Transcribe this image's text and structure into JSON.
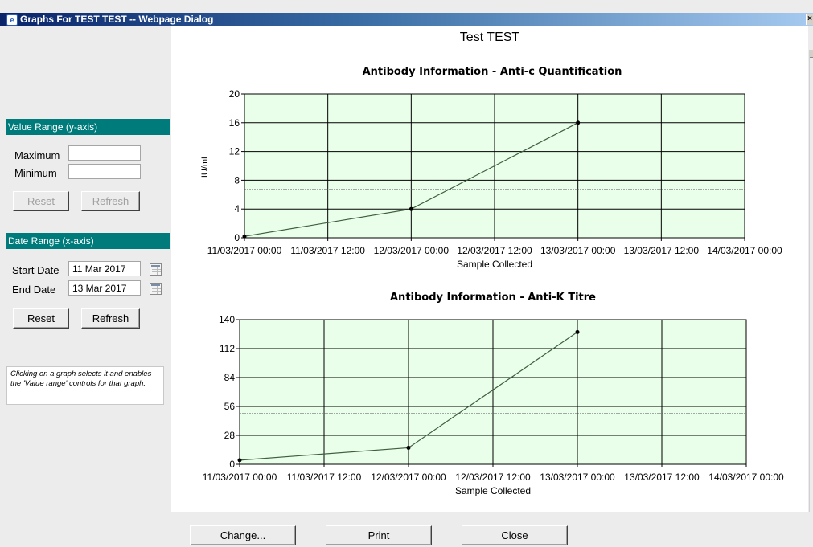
{
  "window": {
    "title": "Graphs For TEST TEST -- Webpage Dialog",
    "icon": "ie-page-icon"
  },
  "page": {
    "title": "Test TEST"
  },
  "value_range": {
    "header": "Value Range (y-axis)",
    "max_label": "Maximum",
    "min_label": "Minimum",
    "max_value": "",
    "min_value": "",
    "reset_label": "Reset",
    "refresh_label": "Refresh",
    "enabled": false
  },
  "date_range": {
    "header": "Date Range (x-axis)",
    "start_label": "Start Date",
    "end_label": "End Date",
    "start_value": "11 Mar 2017",
    "end_value": "13 Mar 2017",
    "reset_label": "Reset",
    "refresh_label": "Refresh"
  },
  "note": "Clicking on a graph selects it and enables the 'Value range' controls for that graph.",
  "footer": {
    "change_label": "Change...",
    "print_label": "Print",
    "close_label": "Close"
  },
  "colors": {
    "header_teal": "#007b7b",
    "plot_bg": "#eaffea",
    "line": "#3f5f3f",
    "title_gradient_start": "#0a246a"
  },
  "chart_data": [
    {
      "type": "line",
      "title": "Antibody Information - Anti-c Quantification",
      "xlabel": "Sample Collected",
      "ylabel": "IU/mL",
      "x_ticks": [
        "11/03/2017 00:00",
        "11/03/2017 12:00",
        "12/03/2017 00:00",
        "12/03/2017 12:00",
        "13/03/2017 00:00",
        "13/03/2017 12:00",
        "14/03/2017 00:00"
      ],
      "y_ticks": [
        0,
        4,
        8,
        12,
        16,
        20
      ],
      "ylim": [
        0,
        20
      ],
      "xlim": [
        "11/03/2017 00:00",
        "14/03/2017 00:00"
      ],
      "grid": true,
      "series": [
        {
          "x": [
            "11/03/2017 00:00",
            "12/03/2017 00:00",
            "13/03/2017 00:00"
          ],
          "y": [
            0.2,
            4,
            16
          ]
        }
      ],
      "reference_line": 6.7
    },
    {
      "type": "line",
      "title": "Antibody Information - Anti-K Titre",
      "xlabel": "Sample Collected",
      "ylabel": "",
      "x_ticks": [
        "11/03/2017 00:00",
        "11/03/2017 12:00",
        "12/03/2017 00:00",
        "12/03/2017 12:00",
        "13/03/2017 00:00",
        "13/03/2017 12:00",
        "14/03/2017 00:00"
      ],
      "y_ticks": [
        0,
        28,
        56,
        84,
        112,
        140
      ],
      "ylim": [
        0,
        140
      ],
      "xlim": [
        "11/03/2017 00:00",
        "14/03/2017 00:00"
      ],
      "grid": true,
      "series": [
        {
          "x": [
            "11/03/2017 00:00",
            "12/03/2017 00:00",
            "13/03/2017 00:00"
          ],
          "y": [
            4,
            16,
            128
          ]
        }
      ],
      "reference_line": 49
    }
  ]
}
